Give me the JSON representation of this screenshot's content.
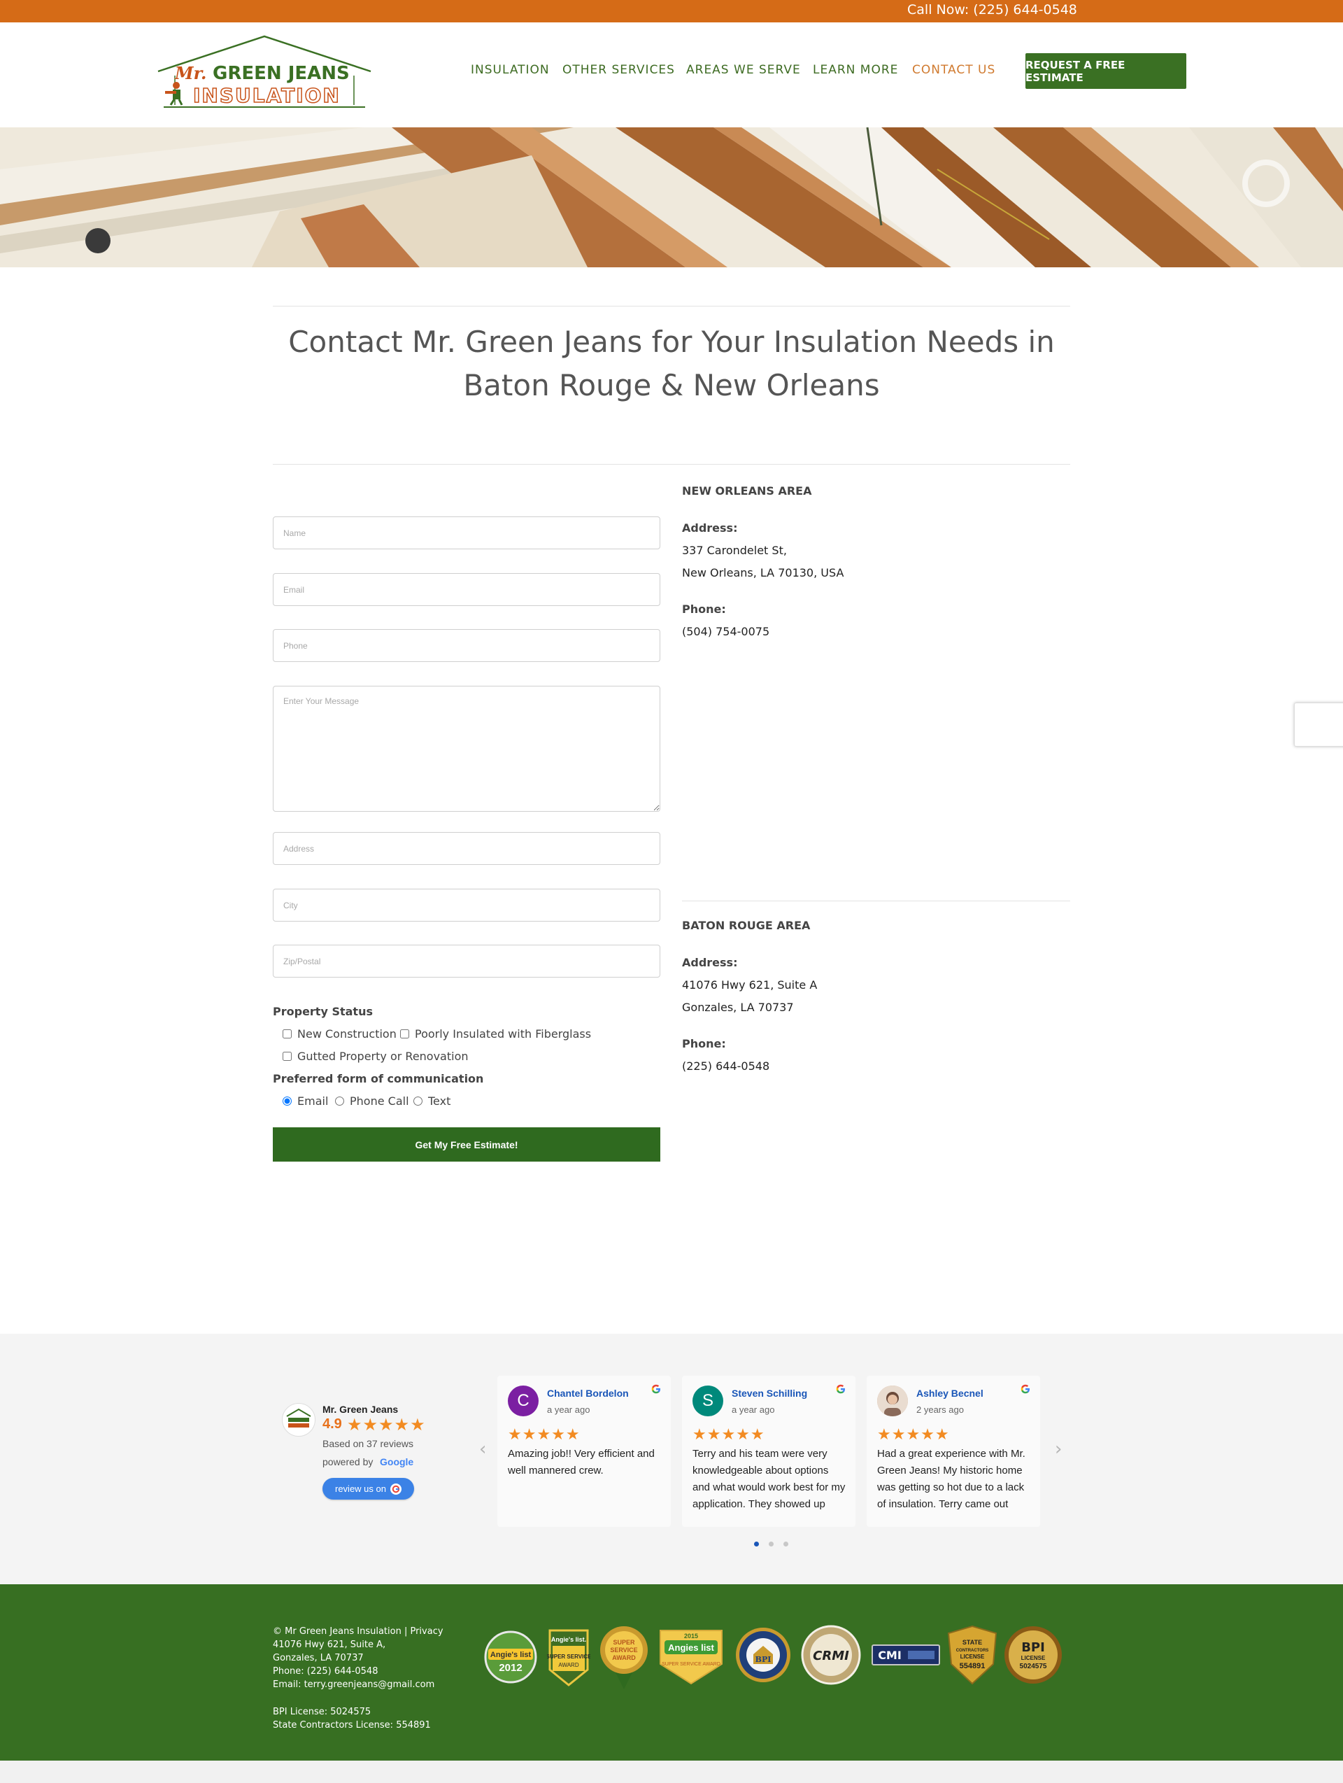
{
  "topbar": {
    "call_text": "Call Now: (225) 644-0548"
  },
  "logo": {
    "line1_mr": "Mr.",
    "line1_name": "GREEN JEANS",
    "line2": "INSULATION"
  },
  "nav": {
    "items": [
      {
        "label": "INSULATION"
      },
      {
        "label": "OTHER SERVICES"
      },
      {
        "label": "AREAS WE SERVE"
      },
      {
        "label": "LEARN MORE"
      },
      {
        "label": "CONTACT US",
        "active": true
      }
    ],
    "cta_label": "REQUEST A FREE ESTIMATE"
  },
  "page": {
    "title_line1": "Contact Mr. Green Jeans for Your Insulation Needs in",
    "title_line2": "Baton Rouge & New Orleans"
  },
  "form": {
    "name_placeholder": "Name",
    "email_placeholder": "Email",
    "phone_placeholder": "Phone",
    "message_placeholder": "Enter Your Message",
    "address_placeholder": "Address",
    "city_placeholder": "City",
    "zip_placeholder": "Zip/Postal",
    "property_status_label": "Property Status",
    "property_options": [
      "New Construction",
      "Poorly Insulated with Fiberglass",
      "Gutted Property or Renovation"
    ],
    "communication_label": "Preferred form of communication",
    "communication_options": [
      "Email",
      "Phone Call",
      "Text"
    ],
    "communication_selected": "Email",
    "submit_label": "Get My Free Estimate!"
  },
  "locations": [
    {
      "title": "NEW ORLEANS AREA",
      "address_label": "Address:",
      "address_line1": "337 Carondelet St,",
      "address_line2": "New Orleans, LA 70130, USA",
      "phone_label": "Phone:",
      "phone": "(504) 754-0075"
    },
    {
      "title": "BATON ROUGE AREA",
      "address_label": "Address:",
      "address_line1": "41076 Hwy 621, Suite A",
      "address_line2": "Gonzales, LA 70737",
      "phone_label": "Phone:",
      "phone": "(225) 644-0548"
    }
  ],
  "reviews": {
    "summary": {
      "name": "Mr. Green Jeans",
      "rating": "4.9",
      "stars": "★★★★★",
      "based_on": "Based on 37 reviews",
      "powered_by": "powered by",
      "google": "Google",
      "review_button": "review us on"
    },
    "cards": [
      {
        "initial": "C",
        "avatar_color": "#7b1fa2",
        "name": "Chantel Bordelon",
        "time": "a year ago",
        "stars": "★★★★★",
        "text": "Amazing job!! Very efficient and well mannered crew."
      },
      {
        "initial": "S",
        "avatar_color": "#00897b",
        "name": "Steven Schilling",
        "time": "a year ago",
        "stars": "★★★★★",
        "text": "Terry and his team were very knowledgeable about options and what would work best for my application. They showed up"
      },
      {
        "initial": "",
        "avatar_color": "#c9a48a",
        "name": "Ashley Becnel",
        "time": "2 years ago",
        "stars": "★★★★★",
        "text": "Had a great experience with Mr. Green Jeans! My historic home was getting so hot due to a lack of insulation. Terry came out"
      }
    ],
    "prev_arrow": "‹",
    "next_arrow": "›"
  },
  "footer": {
    "lines": [
      "© Mr Green Jeans Insulation | Privacy",
      "41076 Hwy 621, Suite A,",
      "Gonzales, LA 70737",
      "Phone: (225) 644-0548",
      "Email: terry.greenjeans@gmail.com"
    ],
    "license_lines": [
      "BPI License: 5024575",
      "State Contractors License: 554891"
    ],
    "badges": {
      "angies_2012_top": "Angie's list",
      "angies_2012_year": "2012",
      "angies_ss_top": "Angie's list.",
      "angies_ss_main": "SUPER SERVICE",
      "angies_ss_sub": "AWARD",
      "ss_award_top": "SUPER",
      "ss_award_mid": "SERVICE",
      "ss_award_bot": "AWARD",
      "angies_2015_year": "2015",
      "angies_2015_name": "Angies list",
      "angies_2015_sub": "SUPER SERVICE AWARD",
      "bpi_seal": "BPI",
      "crmi": "CRMI",
      "cmi": "CMI",
      "state_line1": "STATE",
      "state_line2": "CONTRACTORS",
      "state_line3": "LICENSE",
      "state_number": "554891",
      "bpi_license_line1": "BPI",
      "bpi_license_line2": "LICENSE",
      "bpi_license_number": "5024575"
    }
  }
}
